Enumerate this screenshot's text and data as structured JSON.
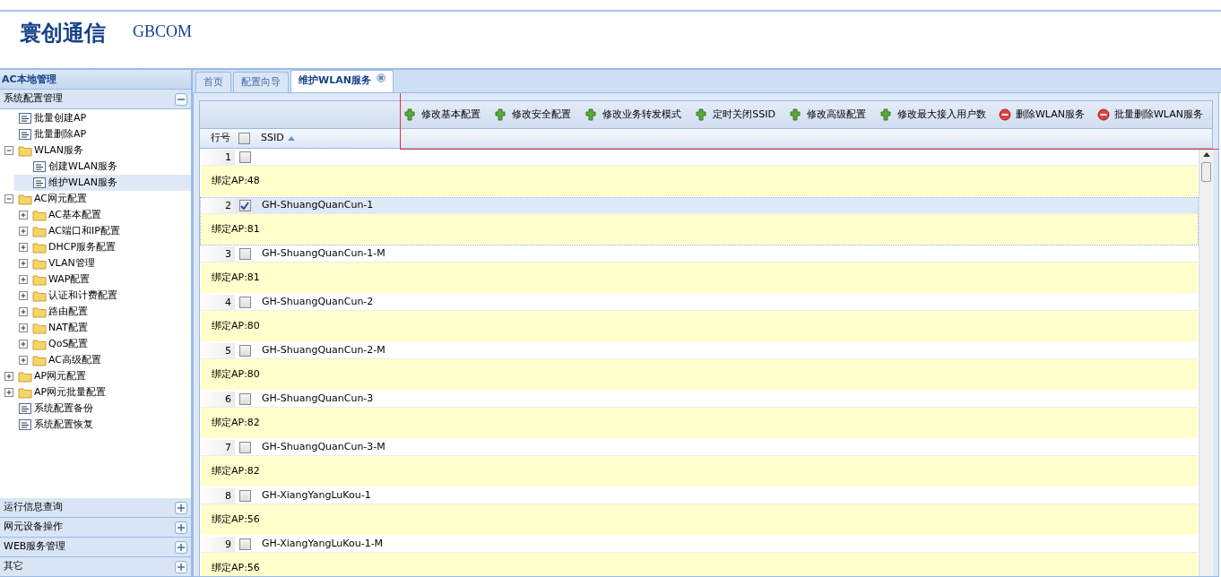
{
  "header": {
    "logo_text": "寰创通信",
    "brand": "GBCOM"
  },
  "sidebar": {
    "title": "AC本地管理",
    "sections": [
      {
        "label": "系统配置管理",
        "expanded": true,
        "items": [
          {
            "label": "批量创建AP",
            "kind": "leaf",
            "selected": false
          },
          {
            "label": "批量删除AP",
            "kind": "leaf",
            "selected": false
          },
          {
            "label": "WLAN服务",
            "kind": "folder",
            "expanded": true,
            "selected": false,
            "children": [
              {
                "label": "创建WLAN服务",
                "kind": "leaf",
                "selected": false
              },
              {
                "label": "维护WLAN服务",
                "kind": "leaf",
                "selected": true
              }
            ]
          },
          {
            "label": "AC网元配置",
            "kind": "folder",
            "expanded": true,
            "selected": false,
            "children": [
              {
                "label": "AC基本配置",
                "kind": "folder",
                "expanded": false,
                "selected": false
              },
              {
                "label": "AC端口和IP配置",
                "kind": "folder",
                "expanded": false,
                "selected": false
              },
              {
                "label": "DHCP服务配置",
                "kind": "folder",
                "expanded": false,
                "selected": false
              },
              {
                "label": "VLAN管理",
                "kind": "folder",
                "expanded": false,
                "selected": false
              },
              {
                "label": "WAP配置",
                "kind": "folder",
                "expanded": false,
                "selected": false
              },
              {
                "label": "认证和计费配置",
                "kind": "folder",
                "expanded": false,
                "selected": false
              },
              {
                "label": "路由配置",
                "kind": "folder",
                "expanded": false,
                "selected": false
              },
              {
                "label": "NAT配置",
                "kind": "folder",
                "expanded": false,
                "selected": false
              },
              {
                "label": "QoS配置",
                "kind": "folder",
                "expanded": false,
                "selected": false
              },
              {
                "label": "AC高级配置",
                "kind": "folder",
                "expanded": false,
                "selected": false
              }
            ]
          },
          {
            "label": "AP网元配置",
            "kind": "folder",
            "expanded": false,
            "selected": false
          },
          {
            "label": "AP网元批量配置",
            "kind": "folder",
            "expanded": false,
            "selected": false
          },
          {
            "label": "系统配置备份",
            "kind": "leaf",
            "selected": false
          },
          {
            "label": "系统配置恢复",
            "kind": "leaf",
            "selected": false
          }
        ]
      },
      {
        "label": "运行信息查询",
        "expanded": false
      },
      {
        "label": "网元设备操作",
        "expanded": false
      },
      {
        "label": "WEB服务管理",
        "expanded": false
      },
      {
        "label": "其它",
        "expanded": false
      }
    ]
  },
  "tabs": [
    {
      "label": "首页",
      "selected": false,
      "closable": false
    },
    {
      "label": "配置向导",
      "selected": false,
      "closable": false
    },
    {
      "label": "维护WLAN服务",
      "selected": true,
      "closable": true
    }
  ],
  "toolbar": [
    {
      "label": "修改基本配置",
      "kind": "edit"
    },
    {
      "label": "修改安全配置",
      "kind": "edit"
    },
    {
      "label": "修改业务转发模式",
      "kind": "edit"
    },
    {
      "label": "定时关闭SSID",
      "kind": "edit"
    },
    {
      "label": "修改高级配置",
      "kind": "edit"
    },
    {
      "label": "修改最大接入用户数",
      "kind": "edit"
    },
    {
      "label": "删除WLAN服务",
      "kind": "delete"
    },
    {
      "label": "批量删除WLAN服务",
      "kind": "delete"
    }
  ],
  "table": {
    "columns": [
      "行号",
      "SSID"
    ],
    "header_checked": false,
    "sort_ascending": true,
    "rows": [
      {
        "index": "1",
        "ssid": "",
        "detail": "绑定AP:48",
        "checked": false,
        "selected": false
      },
      {
        "index": "2",
        "ssid": "GH-ShuangQuanCun-1",
        "detail": "绑定AP:81",
        "checked": true,
        "selected": true
      },
      {
        "index": "3",
        "ssid": "GH-ShuangQuanCun-1-M",
        "detail": "绑定AP:81",
        "checked": false,
        "selected": false
      },
      {
        "index": "4",
        "ssid": "GH-ShuangQuanCun-2",
        "detail": "绑定AP:80",
        "checked": false,
        "selected": false
      },
      {
        "index": "5",
        "ssid": "GH-ShuangQuanCun-2-M",
        "detail": "绑定AP:80",
        "checked": false,
        "selected": false
      },
      {
        "index": "6",
        "ssid": "GH-ShuangQuanCun-3",
        "detail": "绑定AP:82",
        "checked": false,
        "selected": false
      },
      {
        "index": "7",
        "ssid": "GH-ShuangQuanCun-3-M",
        "detail": "绑定AP:82",
        "checked": false,
        "selected": false
      },
      {
        "index": "8",
        "ssid": "GH-XiangYangLuKou-1",
        "detail": "绑定AP:56",
        "checked": false,
        "selected": false
      },
      {
        "index": "9",
        "ssid": "GH-XiangYangLuKou-1-M",
        "detail": "绑定AP:56",
        "checked": false,
        "selected": false
      }
    ]
  }
}
